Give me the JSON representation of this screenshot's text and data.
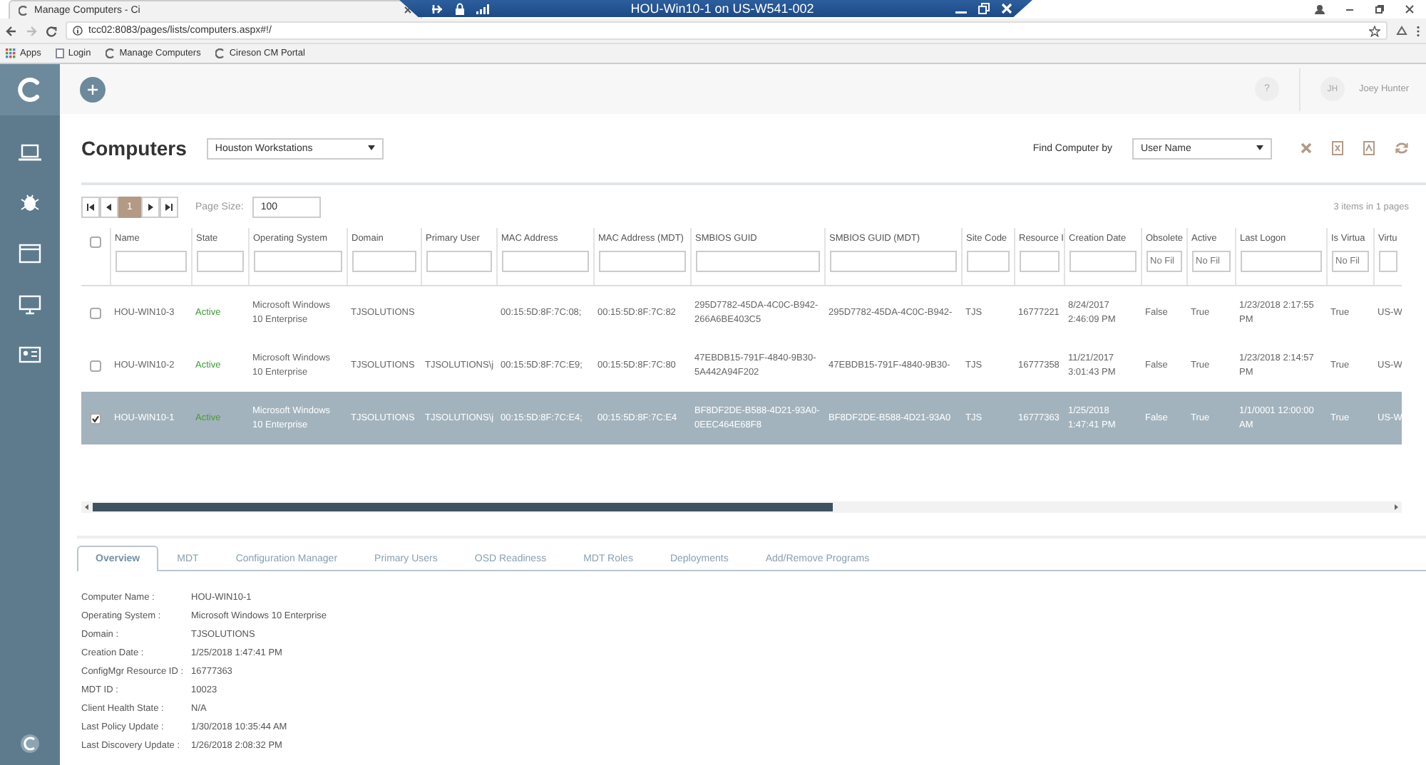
{
  "browser": {
    "tab_title": "Manage Computers - Ci",
    "rdp_title": "HOU-Win10-1 on US-W541-002",
    "url": "tcc02:8083/pages/lists/computers.aspx#!/",
    "bookmarks": [
      {
        "label": "Apps"
      },
      {
        "label": "Login"
      },
      {
        "label": "Manage Computers"
      },
      {
        "label": "Cireson CM Portal"
      }
    ]
  },
  "header": {
    "help": "?",
    "user_initials": "JH",
    "user_name": "Joey Hunter"
  },
  "page": {
    "title": "Computers",
    "view": "Houston Workstations",
    "find_label": "Find Computer by",
    "find_by": "User Name"
  },
  "pager": {
    "pages": [
      {
        "label": "1",
        "selected": true
      }
    ],
    "page_size_label": "Page Size:",
    "page_size": "100",
    "summary": "3 items in 1 pages"
  },
  "table": {
    "all_checked": false,
    "columns": [
      {
        "label": "Name",
        "kind": "text",
        "filter": {
          "kind": "text"
        }
      },
      {
        "label": "State",
        "kind": "status",
        "filter": {
          "kind": "text"
        }
      },
      {
        "label": "Operating System",
        "kind": "text",
        "filter": {
          "kind": "text"
        }
      },
      {
        "label": "Domain",
        "kind": "text",
        "filter": {
          "kind": "text"
        }
      },
      {
        "label": "Primary User",
        "kind": "text",
        "filter": {
          "kind": "text"
        }
      },
      {
        "label": "MAC Address",
        "kind": "text",
        "filter": {
          "kind": "text"
        }
      },
      {
        "label": "MAC Address (MDT)",
        "kind": "text",
        "filter": {
          "kind": "text"
        }
      },
      {
        "label": "SMBIOS GUID",
        "kind": "text",
        "filter": {
          "kind": "text"
        }
      },
      {
        "label": "SMBIOS GUID (MDT)",
        "kind": "text",
        "filter": {
          "kind": "text"
        }
      },
      {
        "label": "Site Code",
        "kind": "text",
        "filter": {
          "kind": "text"
        }
      },
      {
        "label": "Resource I",
        "kind": "text",
        "filter": {
          "kind": "text"
        }
      },
      {
        "label": "Creation Date",
        "kind": "text",
        "filter": {
          "kind": "text"
        }
      },
      {
        "label": "Obsolete",
        "kind": "text",
        "filter": {
          "kind": "select",
          "placeholder": "No Fil"
        }
      },
      {
        "label": "Active",
        "kind": "text",
        "filter": {
          "kind": "select",
          "placeholder": "No Fil"
        }
      },
      {
        "label": "Last Logon",
        "kind": "text",
        "filter": {
          "kind": "text"
        }
      },
      {
        "label": "Is Virtua",
        "kind": "text",
        "filter": {
          "kind": "select",
          "placeholder": "No Fil"
        }
      },
      {
        "label": "Virtu",
        "kind": "text",
        "filter": {
          "kind": "text"
        }
      }
    ],
    "rows": [
      {
        "checked": false,
        "selected": false,
        "cells": [
          "HOU-WIN10-3",
          "Active",
          "Microsoft Windows 10 Enterprise",
          "TJSOLUTIONS",
          null,
          "00:15:5D:8F:7C:08;",
          "00:15:5D:8F:7C:82",
          "295D7782-45DA-4C0C-B942-266A6BE403C5",
          "295D7782-45DA-4C0C-B942-",
          "TJS",
          "16777221",
          "8/24/2017 2:46:09 PM",
          "False",
          "True",
          "1/23/2018 2:17:55 PM",
          "True",
          "US-W"
        ]
      },
      {
        "checked": false,
        "selected": false,
        "cells": [
          "HOU-WIN10-2",
          "Active",
          "Microsoft Windows 10 Enterprise",
          "TJSOLUTIONS",
          "TJSOLUTIONS\\j",
          "00:15:5D:8F:7C:E9;",
          "00:15:5D:8F:7C:80",
          "47EBDB15-791F-4840-9B30-5A442A94F202",
          "47EBDB15-791F-4840-9B30-",
          "TJS",
          "16777358",
          "11/21/2017 3:01:43 PM",
          "False",
          "True",
          "1/23/2018 2:14:57 PM",
          "True",
          "US-W"
        ]
      },
      {
        "checked": true,
        "selected": true,
        "cells": [
          "HOU-WIN10-1",
          "Active",
          "Microsoft Windows 10 Enterprise",
          "TJSOLUTIONS",
          "TJSOLUTIONS\\j",
          "00:15:5D:8F:7C:E4;",
          "00:15:5D:8F:7C:E4",
          "BF8DF2DE-B588-4D21-93A0-0EEC464E68F8",
          "BF8DF2DE-B588-4D21-93A0",
          "TJS",
          "16777363",
          "1/25/2018 1:47:41 PM",
          "False",
          "True",
          "1/1/0001 12:00:00 AM",
          "True",
          "US-W"
        ]
      }
    ]
  },
  "detail_tabs": [
    {
      "label": "Overview",
      "selected": true
    },
    {
      "label": "MDT",
      "selected": false
    },
    {
      "label": "Configuration Manager",
      "selected": false
    },
    {
      "label": "Primary Users",
      "selected": false
    },
    {
      "label": "OSD Readiness",
      "selected": false
    },
    {
      "label": "MDT Roles",
      "selected": false
    },
    {
      "label": "Deployments",
      "selected": false
    },
    {
      "label": "Add/Remove Programs",
      "selected": false
    }
  ],
  "details": [
    {
      "label": "Computer Name :",
      "value": "HOU-WIN10-1"
    },
    {
      "label": "Operating System :",
      "value": "Microsoft Windows 10 Enterprise"
    },
    {
      "label": "Domain :",
      "value": "TJSOLUTIONS"
    },
    {
      "label": "Creation Date :",
      "value": "1/25/2018 1:47:41 PM"
    },
    {
      "label": "ConfigMgr Resource ID :",
      "value": "16777363"
    },
    {
      "label": "MDT ID :",
      "value": "10023"
    },
    {
      "label": "Client Health State :",
      "value": "N/A"
    },
    {
      "label": "Last Policy Update :",
      "value": "1/30/2018 10:35:44 AM"
    },
    {
      "label": "Last Discovery Update :",
      "value": "1/26/2018 2:08:32 PM"
    }
  ]
}
